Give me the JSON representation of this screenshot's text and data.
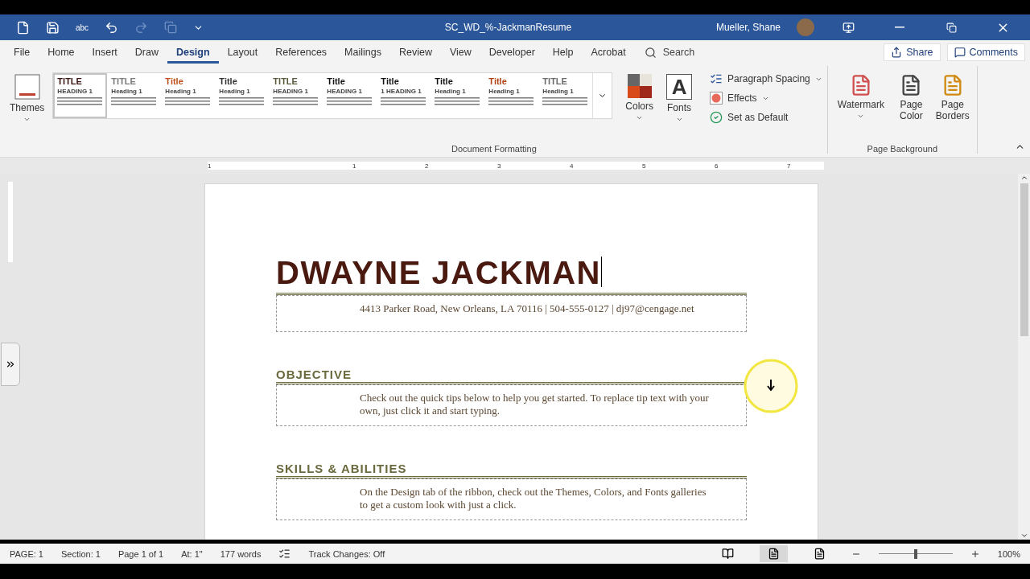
{
  "title_bar": {
    "spelling_label": "abc",
    "document_title": "SC_WD_%-JackmanResume",
    "user": "Mueller, Shane"
  },
  "tabs": [
    {
      "label": "File",
      "selected": false
    },
    {
      "label": "Home",
      "selected": false
    },
    {
      "label": "Insert",
      "selected": false
    },
    {
      "label": "Draw",
      "selected": false
    },
    {
      "label": "Design",
      "selected": true
    },
    {
      "label": "Layout",
      "selected": false
    },
    {
      "label": "References",
      "selected": false
    },
    {
      "label": "Mailings",
      "selected": false
    },
    {
      "label": "Review",
      "selected": false
    },
    {
      "label": "View",
      "selected": false
    },
    {
      "label": "Developer",
      "selected": false
    },
    {
      "label": "Help",
      "selected": false
    },
    {
      "label": "Acrobat",
      "selected": false
    }
  ],
  "search": {
    "placeholder": "Search"
  },
  "share": "Share",
  "comments": "Comments",
  "ribbon": {
    "themes": "Themes",
    "style_gallery": [
      {
        "title": "TITLE",
        "heading": "HEADING 1",
        "color": "#3a1410",
        "selected": true
      },
      {
        "title": "TITLE",
        "heading": "Heading 1",
        "color": "#7a7a7a",
        "selected": false
      },
      {
        "title": "Title",
        "heading": "Heading 1",
        "color": "#c0501a",
        "selected": false
      },
      {
        "title": "Title",
        "heading": "Heading 1",
        "color": "#333333",
        "selected": false
      },
      {
        "title": "TITLE",
        "heading": "HEADING 1",
        "color": "#5b5a3a",
        "selected": false
      },
      {
        "title": "Title",
        "heading": "HEADING 1",
        "color": "#111111",
        "selected": false
      },
      {
        "title": "Title",
        "heading": "1 HEADING 1",
        "color": "#111111",
        "selected": false
      },
      {
        "title": "Title",
        "heading": "Heading 1",
        "color": "#111111",
        "selected": false
      },
      {
        "title": "Title",
        "heading": "Heading 1",
        "color": "#b04010",
        "selected": false
      },
      {
        "title": "TITLE",
        "heading": "Heading 1",
        "color": "#6a6a6a",
        "selected": false
      }
    ],
    "colors": "Colors",
    "fonts_glyph": "A",
    "fonts": "Fonts",
    "paragraph_spacing": "Paragraph Spacing",
    "effects": "Effects",
    "set_as_default": "Set as Default",
    "document_formatting": "Document Formatting",
    "watermark": "Watermark",
    "page_color": "Page Color",
    "page_borders": "Page Borders",
    "page_background": "Page Background"
  },
  "ruler": [
    "1",
    "1",
    "2",
    "3",
    "4",
    "5",
    "6",
    "7"
  ],
  "document": {
    "name": "DWAYNE JACKMAN",
    "contact": "4413 Parker Road, New Orleans, LA 70116 | 504-555-0127 | dj97@cengage.net",
    "sections": [
      {
        "heading": "OBJECTIVE",
        "body": "Check out the quick tips below to help you get started. To replace tip text with your own, just click it and start typing."
      },
      {
        "heading": "SKILLS & ABILITIES",
        "body": "On the Design tab of the ribbon, check out the Themes, Colors, and Fonts galleries to get a custom look with just a click."
      }
    ]
  },
  "status_bar": {
    "items": [
      "PAGE: 1",
      "Section: 1",
      "Page 1 of 1",
      "At: 1\"",
      "177 words"
    ],
    "track_changes": "Track Changes: Off",
    "zoom": {
      "level": 0.5,
      "reading": "100%"
    }
  }
}
